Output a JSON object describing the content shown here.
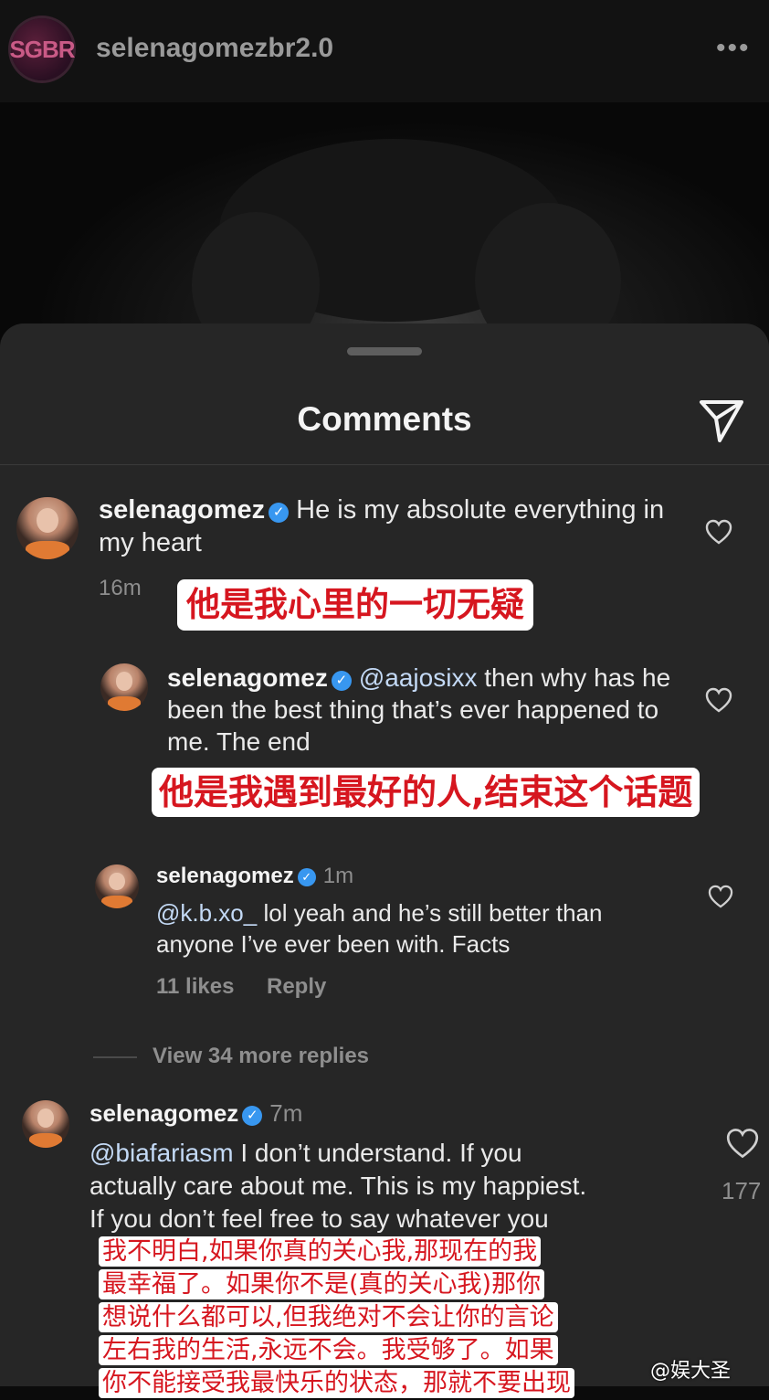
{
  "post": {
    "avatar_text": "SGBR",
    "username": "selenagomezbr2.0",
    "more_icon": "more-icon"
  },
  "sheet": {
    "title": "Comments",
    "share_icon": "paper-plane-icon"
  },
  "comments": [
    {
      "username": "selenagomez",
      "text": "He is my absolute everything in my heart",
      "time": "16m",
      "translation": "他是我心里的一切无疑"
    },
    {
      "username": "selenagomez",
      "mention": "@aajosixx",
      "text": "then why has he been the best thing that’s ever happened to me. The end",
      "translation": "他是我遇到最好的人,结束这个话题"
    },
    {
      "username": "selenagomez",
      "time": "1m",
      "mention": "@k.b.xo_",
      "text": "lol yeah and he’s still better than anyone I’ve ever been with. Facts",
      "likes": "11 likes",
      "reply": "Reply"
    },
    {
      "username": "selenagomez",
      "time": "7m",
      "mention": "@biafariasm",
      "text_line1": "I don’t understand. If you",
      "text_line2": "actually care about me. This is my happiest.",
      "text_line3": "If you don’t feel free to say whatever you",
      "like_count": "177",
      "translation_lines": [
        "我不明白,如果你真的关心我,那现在的我",
        "最幸福了。如果你不是(真的关心我)那你",
        "想说什么都可以,但我绝对不会让你的言论",
        "左右我的生活,永远不会。我受够了。如果",
        "你不能接受我最快乐的状态，那就不要出现"
      ]
    }
  ],
  "view_more_replies": "View 34 more replies",
  "watermark": "@娱大圣",
  "colors": {
    "accent_verified": "#3897f0",
    "translation_red": "#d6161f",
    "sheet_bg": "#262626"
  }
}
